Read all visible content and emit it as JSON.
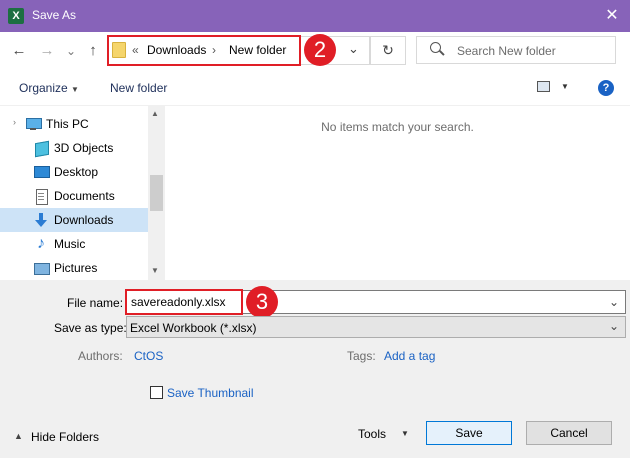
{
  "window": {
    "title": "Save As",
    "app_icon": "X",
    "close": "✕"
  },
  "nav": {
    "back": "←",
    "forward": "→",
    "recent": "⌄",
    "up": "↑",
    "breadcrumb": {
      "prefix": "«",
      "segments": [
        "Downloads",
        "New folder"
      ],
      "separator": "›"
    },
    "refresh": "↻",
    "search": {
      "placeholder": "Search New folder"
    },
    "step_badge": "2"
  },
  "toolbar": {
    "organize": "Organize",
    "new_folder": "New folder",
    "view_arrow": "▼"
  },
  "sidebar": {
    "items": [
      {
        "label": "This PC",
        "icon": "monitor-icon"
      },
      {
        "label": "3D Objects",
        "icon": "cube-icon"
      },
      {
        "label": "Desktop",
        "icon": "desktop-icon"
      },
      {
        "label": "Documents",
        "icon": "document-icon"
      },
      {
        "label": "Downloads",
        "icon": "download-arrow-icon",
        "selected": true
      },
      {
        "label": "Music",
        "icon": "music-note-icon"
      },
      {
        "label": "Pictures",
        "icon": "picture-icon"
      }
    ]
  },
  "content": {
    "empty_message": "No items match your search."
  },
  "form": {
    "file_name_label": "File name:",
    "file_name_value": "savereadonly.xlsx",
    "step_badge": "3",
    "save_type_label": "Save as type:",
    "save_type_value": "Excel Workbook (*.xlsx)",
    "authors_label": "Authors:",
    "authors_value": "CtOS",
    "tags_label": "Tags:",
    "tags_value": "Add a tag",
    "thumbnail_label": "Save Thumbnail"
  },
  "footer": {
    "hide_folders": "Hide Folders",
    "tools": "Tools",
    "save": "Save",
    "cancel": "Cancel"
  },
  "colors": {
    "titlebar": "#8763b9",
    "highlight": "#e01e26",
    "accent": "#1a62c4"
  }
}
